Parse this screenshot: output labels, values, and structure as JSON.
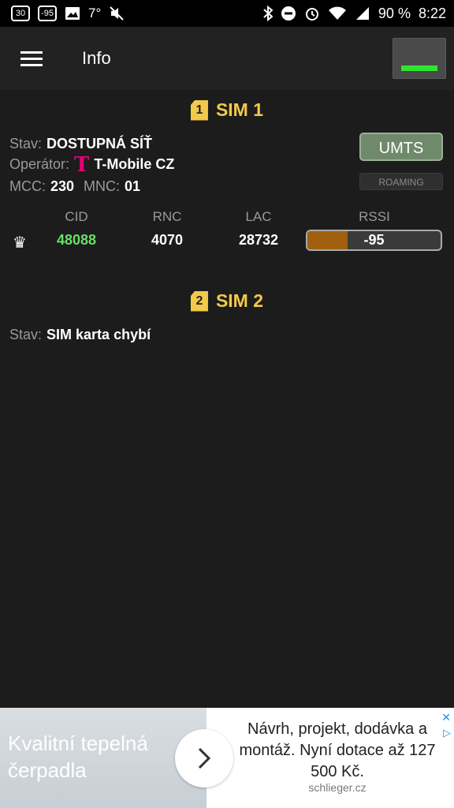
{
  "status_bar": {
    "left_icons": [
      {
        "name": "calendar-icon",
        "text": "30"
      },
      {
        "name": "signal-strength-icon",
        "text": "-95"
      },
      {
        "name": "image-icon",
        "text": ""
      },
      {
        "name": "temperature-text",
        "text": "7°"
      },
      {
        "name": "mute-icon",
        "text": ""
      }
    ],
    "battery": "90 %",
    "time": "8:22"
  },
  "appbar": {
    "title": "Info"
  },
  "sim1": {
    "badge": "1",
    "title": "SIM 1",
    "status_label": "Stav:",
    "status_value": "DOSTUPNÁ SÍŤ",
    "operator_label": "Operátor:",
    "operator_logo": "T",
    "operator_value": "T-Mobile CZ",
    "mcc_label": "MCC:",
    "mcc_value": "230",
    "mnc_label": "MNC:",
    "mnc_value": "01",
    "network_type": "UMTS",
    "roaming": "ROAMING",
    "cell_headers": [
      "CID",
      "RNC",
      "LAC",
      "RSSI"
    ],
    "cid": "48088",
    "rnc": "4070",
    "lac": "28732",
    "rssi": "-95",
    "rssi_level_percent": 30,
    "cid_color": "#66e066",
    "rssi_fill_color": "#a06010"
  },
  "sim2": {
    "badge": "2",
    "title": "SIM 2",
    "status_label": "Stav:",
    "status_value": "SIM karta chybí"
  },
  "ad": {
    "image_text": "Kvalitní tepelná čerpadla",
    "copy": "Návrh, projekt, dodávka a montáž. Nyní dotace až 127 500 Kč.",
    "domain": "schlieger.cz",
    "close": "✕",
    "choice": "▷"
  },
  "colors": {
    "accent": "#f2c94c",
    "background": "#1c1c1c",
    "appbar": "#222222",
    "signal_bar": "#2ee52e"
  }
}
